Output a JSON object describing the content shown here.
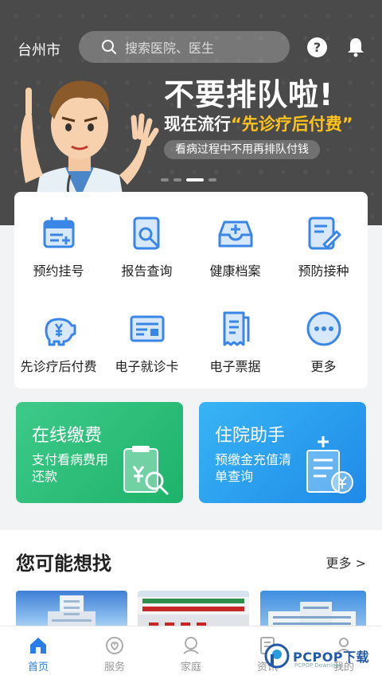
{
  "header": {
    "city": "台州市",
    "search_placeholder": "搜索医院、医生",
    "help_label": "?"
  },
  "banner": {
    "title": "不要排队啦!",
    "subtitle_prefix": "现在流行",
    "subtitle_highlight": "“先诊疗后付费”",
    "pill": "看病过程中不用再排队付钱",
    "dots_count": 4,
    "active_dot": 2
  },
  "services": [
    {
      "label": "预约挂号",
      "icon": "calendar-icon"
    },
    {
      "label": "报告查询",
      "icon": "report-search-icon"
    },
    {
      "label": "健康档案",
      "icon": "health-record-icon"
    },
    {
      "label": "预防接种",
      "icon": "vaccine-icon"
    },
    {
      "label": "先诊疗后付费",
      "icon": "piggy-bank-icon"
    },
    {
      "label": "电子就诊卡",
      "icon": "card-icon"
    },
    {
      "label": "电子票据",
      "icon": "receipt-icon"
    },
    {
      "label": "更多",
      "icon": "more-icon"
    }
  ],
  "promos": [
    {
      "title": "在线缴费",
      "desc": "支付看病费用还款",
      "icon": "payment-icon",
      "color": "#1db36a"
    },
    {
      "title": "住院助手",
      "desc": "预缴金充值清单查询",
      "icon": "hospital-bill-icon",
      "color": "#1f8ae8"
    }
  ],
  "section": {
    "title": "您可能想找",
    "more": "更多 >"
  },
  "tabs": [
    {
      "label": "首页",
      "icon": "home-icon",
      "active": true
    },
    {
      "label": "服务",
      "icon": "service-icon",
      "active": false
    },
    {
      "label": "家庭",
      "icon": "family-icon",
      "active": false
    },
    {
      "label": "资讯",
      "icon": "news-icon",
      "active": false
    },
    {
      "label": "我的",
      "icon": "profile-icon",
      "active": false
    }
  ],
  "watermark": {
    "text": "PCPOP下载",
    "sub": "PCPOP Download"
  },
  "colors": {
    "accent": "#2b7de9",
    "icon_blue": "#3a86e6",
    "highlight": "#ffc21a"
  }
}
